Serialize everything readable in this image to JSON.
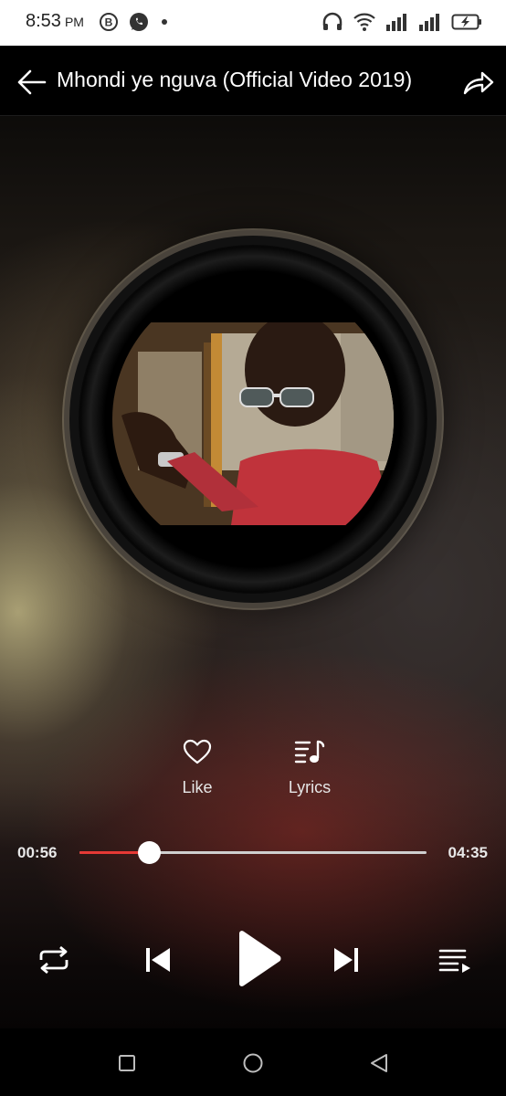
{
  "status_bar": {
    "time": "8:53",
    "ampm": "PM",
    "left_icons": [
      "b-circle-icon",
      "whatsapp-icon",
      "dot-icon"
    ],
    "right_icons": [
      "headphones-icon",
      "wifi-icon",
      "signal-icon",
      "signal-icon",
      "battery-charging-icon"
    ]
  },
  "app_bar": {
    "title": "Mhondi ye nguva (Official Video 2019)"
  },
  "actions": {
    "like_label": "Like",
    "lyrics_label": "Lyrics"
  },
  "player": {
    "current_time": "00:56",
    "total_time": "04:35",
    "progress": 0.2,
    "accent_color": "#e53935"
  },
  "controls": [
    "repeat-icon",
    "previous-icon",
    "play-icon",
    "next-icon",
    "queue-icon"
  ],
  "nav": [
    "recent-apps-icon",
    "home-icon",
    "back-icon"
  ]
}
